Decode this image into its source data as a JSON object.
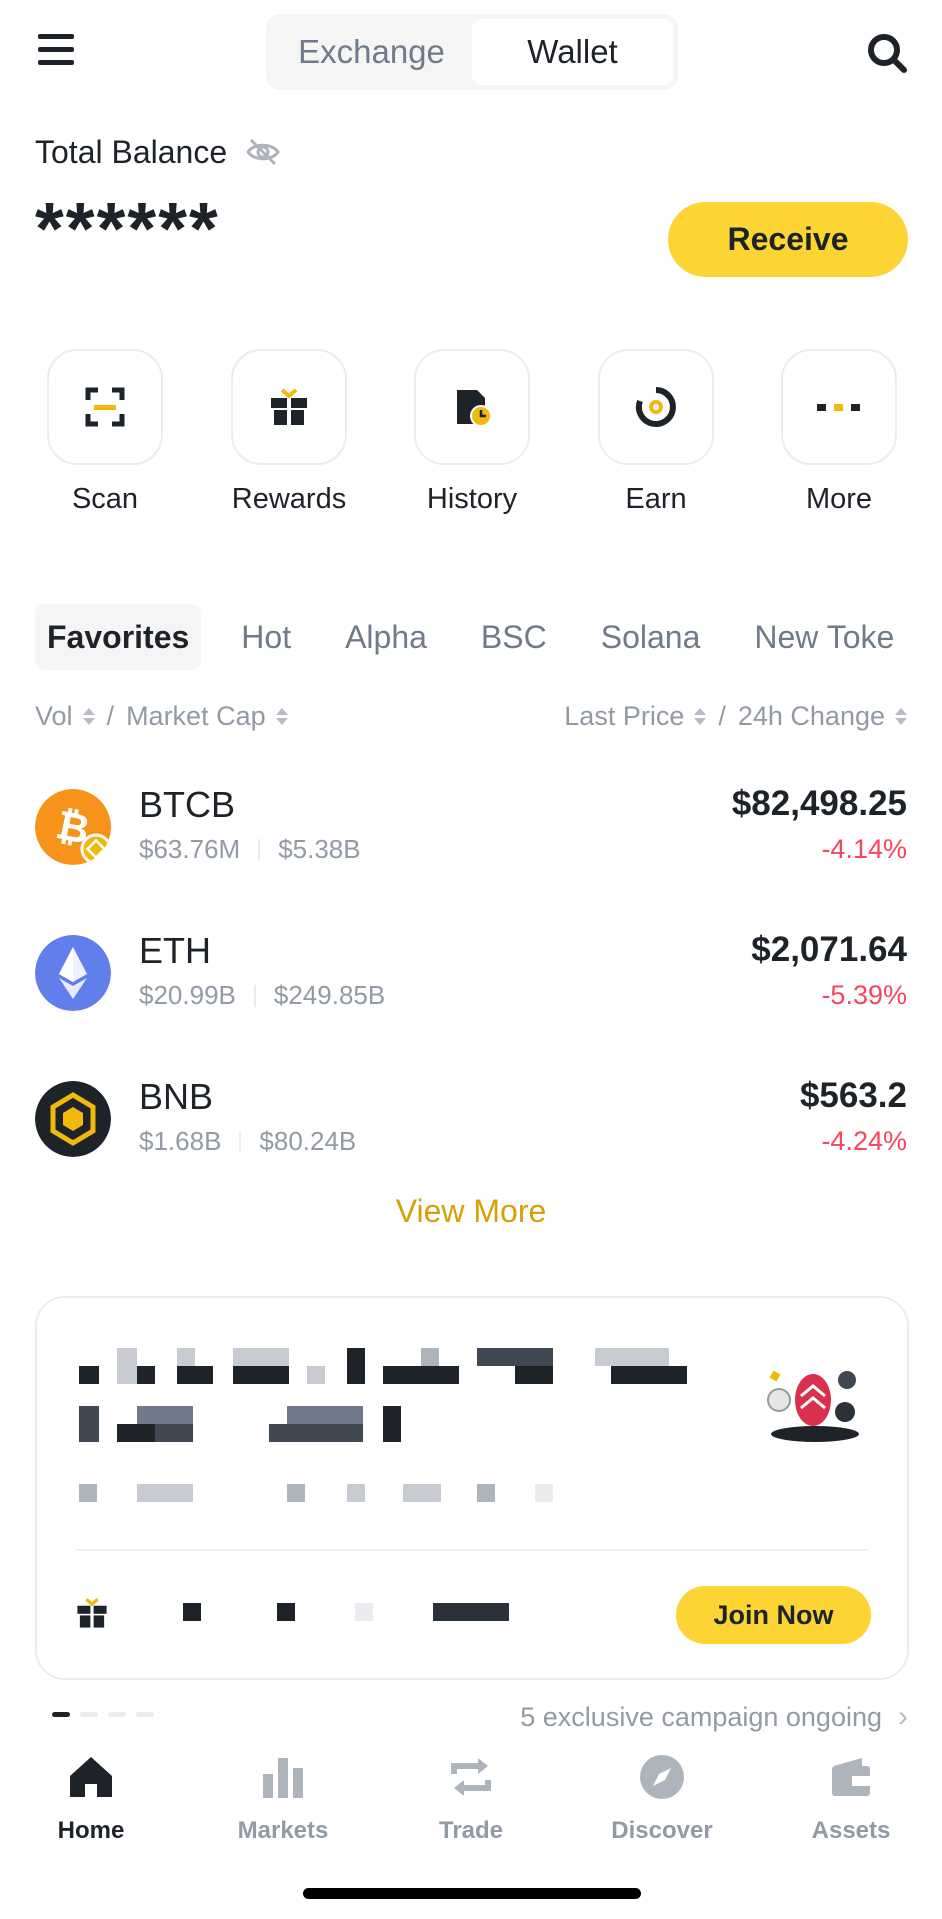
{
  "header": {
    "tabs": [
      {
        "label": "Exchange",
        "active": false
      },
      {
        "label": "Wallet",
        "active": true
      }
    ],
    "menu_icon": "hamburger-menu-icon",
    "search_icon": "search-icon"
  },
  "balance": {
    "label": "Total Balance",
    "value": "******",
    "hidden_icon": "eye-off-icon",
    "receive_label": "Receive"
  },
  "quick_actions": [
    {
      "label": "Scan",
      "icon": "scan-icon"
    },
    {
      "label": "Rewards",
      "icon": "gift-icon"
    },
    {
      "label": "History",
      "icon": "history-icon"
    },
    {
      "label": "Earn",
      "icon": "earn-icon"
    },
    {
      "label": "More",
      "icon": "more-dots-icon"
    }
  ],
  "market_tabs": [
    "Favorites",
    "Hot",
    "Alpha",
    "BSC",
    "Solana",
    "New Toke"
  ],
  "sort": {
    "left_a": "Vol",
    "left_b": "Market Cap",
    "right_a": "Last Price",
    "right_b": "24h Change",
    "separator": "/"
  },
  "coins": [
    {
      "symbol": "BTCB",
      "volume": "$63.76M",
      "market_cap": "$5.38B",
      "price": "$82,498.25",
      "change": "-4.14%"
    },
    {
      "symbol": "ETH",
      "volume": "$20.99B",
      "market_cap": "$249.85B",
      "price": "$2,071.64",
      "change": "-5.39%"
    },
    {
      "symbol": "BNB",
      "volume": "$1.68B",
      "market_cap": "$80.24B",
      "price": "$563.2",
      "change": "-4.24%"
    }
  ],
  "view_more": "View More",
  "promo": {
    "join_label": "Join Now",
    "campaign_text": "5 exclusive campaign ongoing",
    "chevron": "›"
  },
  "bottom_nav": [
    {
      "label": "Home",
      "icon": "home-icon",
      "active": true
    },
    {
      "label": "Markets",
      "icon": "markets-icon",
      "active": false
    },
    {
      "label": "Trade",
      "icon": "trade-icon",
      "active": false
    },
    {
      "label": "Discover",
      "icon": "discover-icon",
      "active": false
    },
    {
      "label": "Assets",
      "icon": "assets-icon",
      "active": false
    }
  ],
  "colors": {
    "accent": "#fcd535",
    "accent_text": "#d89f06",
    "negative": "#f6465d",
    "text_primary": "#1e2329",
    "text_secondary": "#929aa5"
  }
}
